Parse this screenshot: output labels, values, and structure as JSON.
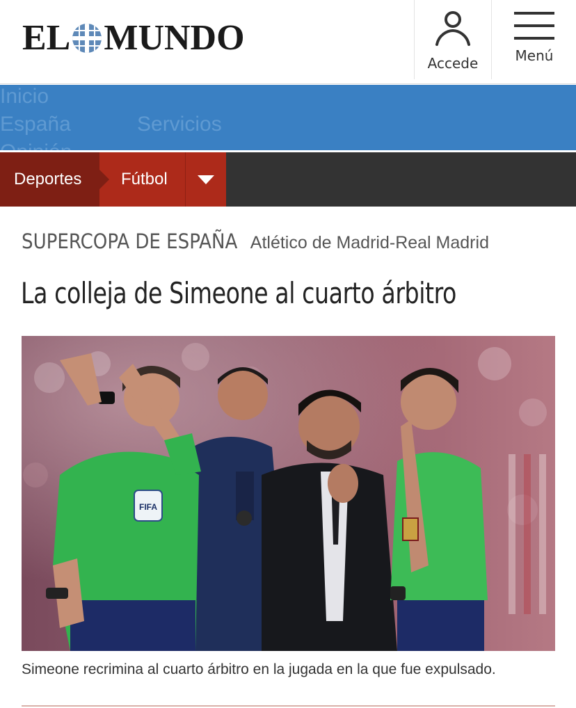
{
  "header": {
    "logo_text_left": "EL",
    "logo_text_right": "MUNDO",
    "accede_label": "Accede",
    "menu_label": "Menú"
  },
  "section_nav": {
    "items": [
      "Inicio",
      "España",
      "Servicios",
      "Opinión"
    ]
  },
  "breadcrumb": {
    "deportes_label": "Deportes",
    "futbol_label": "Fútbol"
  },
  "article": {
    "section": "SUPERCOPA DE ESPAÑA",
    "subsection": "Atlético de Madrid-Real Madrid",
    "title": "La colleja de Simeone al cuarto árbitro",
    "caption": "Simeone recrimina al cuarto árbitro en la jugada en la que fue expulsado.",
    "badge_text": "FIFA"
  },
  "colors": {
    "nav_blue": "#3a80c3",
    "crumb_dark_red": "#7e1f14",
    "crumb_red": "#ad2a1a",
    "crumb_bar": "#333333"
  }
}
